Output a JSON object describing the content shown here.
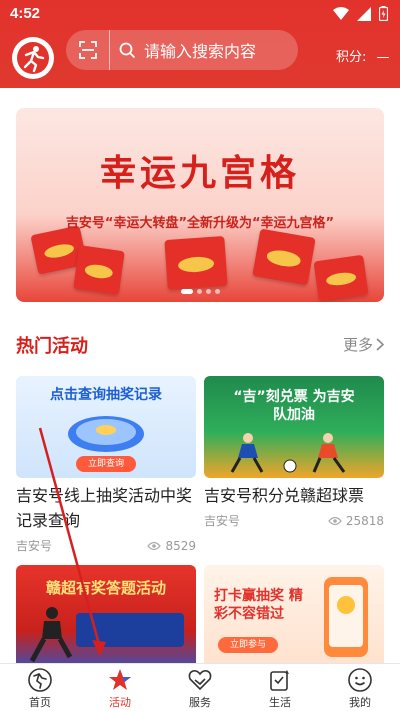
{
  "status": {
    "time": "4:52"
  },
  "search": {
    "placeholder": "请输入搜索内容"
  },
  "points": {
    "label": "积分:",
    "value": "—"
  },
  "banner": {
    "title": "幸运九宫格",
    "subtitle": "吉安号“幸运大转盘”全新升级为“幸运九宫格”",
    "pages": 4,
    "active_page": 0
  },
  "section": {
    "title": "热门活动",
    "more": "更多"
  },
  "cards": [
    {
      "thumb_text": "点击查询抽奖记录",
      "thumb_button": "立即查询",
      "title": "吉安号线上抽奖活动中奖记录查询",
      "source": "吉安号",
      "views": "8529"
    },
    {
      "thumb_text": "“吉”刻兑票 为吉安队加油",
      "title": "吉安号积分兑赣超球票",
      "source": "吉安号",
      "views": "25818"
    },
    {
      "thumb_text": "赣超有奖答题活动",
      "title": "",
      "source": "",
      "views": ""
    },
    {
      "thumb_text": "打卡赢抽奖 精彩不容错过",
      "thumb_button": "立即参与",
      "title": "",
      "source": "",
      "views": ""
    }
  ],
  "tabs": [
    {
      "label": "首页",
      "icon": "home-icon"
    },
    {
      "label": "活动",
      "icon": "star-icon",
      "active": true
    },
    {
      "label": "服务",
      "icon": "heart-hands-icon"
    },
    {
      "label": "生活",
      "icon": "life-icon"
    },
    {
      "label": "我的",
      "icon": "user-icon"
    }
  ],
  "colors": {
    "brand": "#e2322c",
    "active_tab": "#e0312b",
    "section_title": "#d71f1a"
  }
}
